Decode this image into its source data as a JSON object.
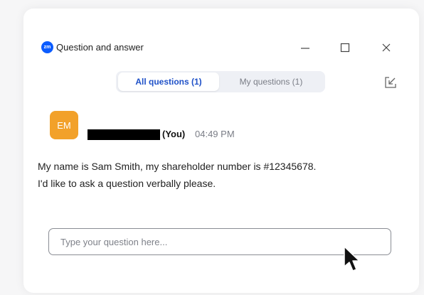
{
  "window": {
    "title": "Question and answer",
    "logo_text": "zm",
    "controls": [
      "minimize-icon",
      "maximize-icon",
      "close-icon"
    ]
  },
  "tabs": [
    {
      "label": "All questions (1)",
      "active": true
    },
    {
      "label": "My questions (1)",
      "active": false
    }
  ],
  "toolbar": {
    "popout_icon": "popout-icon"
  },
  "question": {
    "avatar_initials": "EM",
    "avatar_color": "#f2a12a",
    "you_label": "(You)",
    "time": "04:49 PM",
    "text_line1": "My name is Sam Smith, my shareholder number is #12345678.",
    "text_line2": "I'd like to ask a question verbally please."
  },
  "composer": {
    "placeholder": "Type your question here...",
    "value": ""
  },
  "colors": {
    "accent": "#1f51c8",
    "brand": "#0b5cff"
  }
}
